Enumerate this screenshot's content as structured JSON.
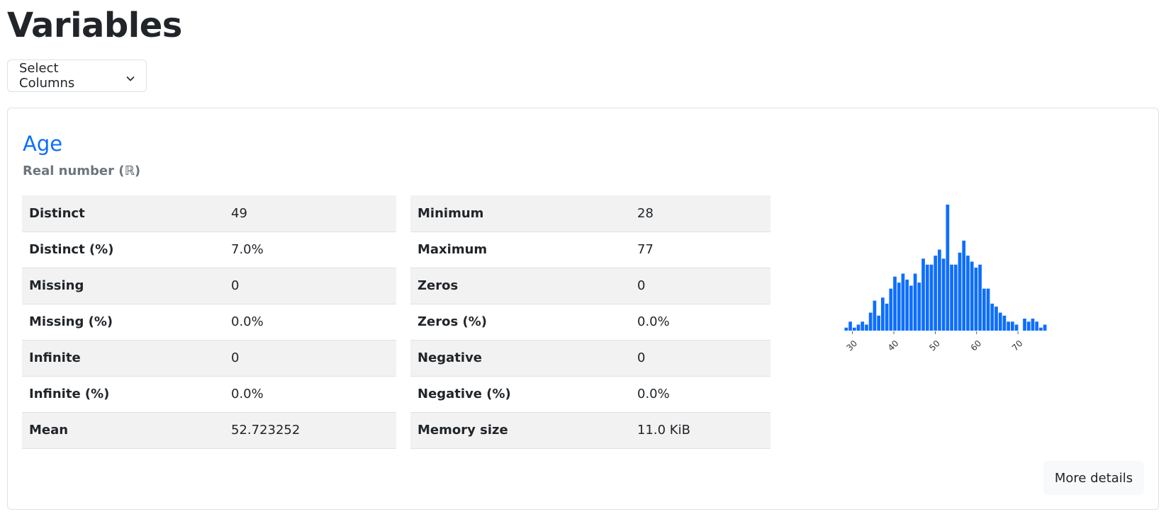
{
  "page": {
    "title": "Variables"
  },
  "select_columns": {
    "label": "Select Columns",
    "icon": "chevron-down-icon"
  },
  "variable": {
    "name": "Age",
    "type": "Real number (ℝ)",
    "left_stats": [
      {
        "label": "Distinct",
        "value": "49"
      },
      {
        "label": "Distinct (%)",
        "value": "7.0%"
      },
      {
        "label": "Missing",
        "value": "0"
      },
      {
        "label": "Missing (%)",
        "value": "0.0%"
      },
      {
        "label": "Infinite",
        "value": "0"
      },
      {
        "label": "Infinite (%)",
        "value": "0.0%"
      },
      {
        "label": "Mean",
        "value": "52.723252"
      }
    ],
    "right_stats": [
      {
        "label": "Minimum",
        "value": "28"
      },
      {
        "label": "Maximum",
        "value": "77"
      },
      {
        "label": "Zeros",
        "value": "0"
      },
      {
        "label": "Zeros (%)",
        "value": "0.0%"
      },
      {
        "label": "Negative",
        "value": "0"
      },
      {
        "label": "Negative (%)",
        "value": "0.0%"
      },
      {
        "label": "Memory size",
        "value": "11.0 KiB"
      }
    ],
    "more_details_label": "More details"
  },
  "chart_data": {
    "type": "bar",
    "title": "",
    "xlabel": "",
    "ylabel": "",
    "bar_color": "#0d6efd",
    "x_range": [
      28,
      77
    ],
    "x_ticks": [
      30,
      40,
      50,
      60,
      70
    ],
    "tick_labels": [
      "30",
      "40",
      "50",
      "60",
      "70"
    ],
    "bins": 50,
    "counts": [
      1,
      3,
      1,
      2,
      3,
      2,
      6,
      10,
      5,
      11,
      9,
      14,
      18,
      16,
      19,
      17,
      15,
      19,
      16,
      24,
      22,
      22,
      25,
      27,
      24,
      42,
      22,
      22,
      26,
      30,
      25,
      23,
      21,
      22,
      14,
      14,
      9,
      8,
      6,
      5,
      3,
      3,
      2,
      0,
      4,
      3,
      4,
      3,
      1,
      2
    ],
    "y_range": [
      0,
      42
    ]
  }
}
